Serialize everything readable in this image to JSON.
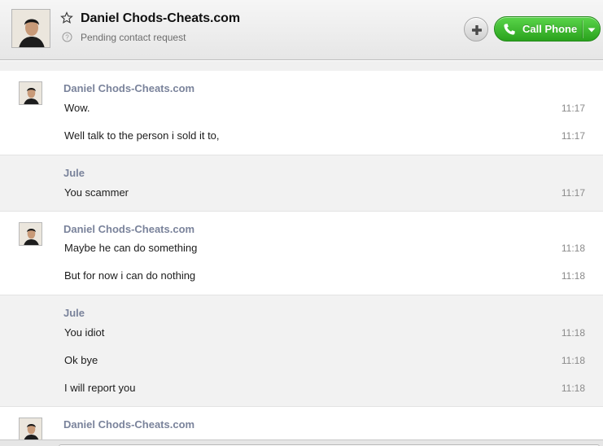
{
  "header": {
    "contact_name": "Daniel Chods-Cheats.com",
    "status": "Pending contact request",
    "call_label": "Call Phone",
    "icons": {
      "favorite": "star-icon",
      "pending": "pending-request-icon",
      "add": "plus-icon",
      "phone": "phone-icon",
      "dropdown": "chevron-down-icon"
    }
  },
  "colors": {
    "call_button": "#2aa21d",
    "sender_name": "#7a839b",
    "alt_row": "#f2f2f2"
  },
  "conversation": {
    "groups": [
      {
        "sender": "Daniel Chods-Cheats.com",
        "has_avatar": true,
        "messages": [
          {
            "text": "Wow.",
            "time": "11:17"
          },
          {
            "text": "Well talk to the person i sold it to,",
            "time": "11:17"
          }
        ]
      },
      {
        "sender": "Jule",
        "has_avatar": false,
        "messages": [
          {
            "text": "You scammer",
            "time": "11:17"
          }
        ]
      },
      {
        "sender": "Daniel Chods-Cheats.com",
        "has_avatar": true,
        "messages": [
          {
            "text": "Maybe he can do something",
            "time": "11:18"
          },
          {
            "text": "But for now i can do nothing",
            "time": "11:18"
          }
        ]
      },
      {
        "sender": "Jule",
        "has_avatar": false,
        "messages": [
          {
            "text": "You idiot",
            "time": "11:18"
          },
          {
            "text": "Ok bye",
            "time": "11:18"
          },
          {
            "text": "I will report you",
            "time": "11:18"
          }
        ]
      },
      {
        "sender": "Daniel Chods-Cheats.com",
        "has_avatar": true,
        "messages": []
      }
    ]
  }
}
